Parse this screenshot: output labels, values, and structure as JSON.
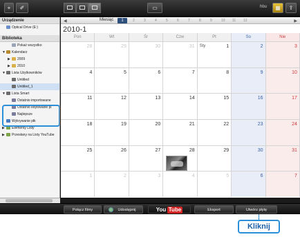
{
  "toolbar": {
    "add_label": "+",
    "tool_label": "✐",
    "tv_label": "hbu",
    "view_modes": [
      "list",
      "grid",
      "calendar"
    ],
    "active_view": "calendar"
  },
  "sidebar": {
    "device_header": "Urządzenie",
    "device_items": [
      {
        "label": "Optical Drive (E:)",
        "icon": "disc-icon"
      }
    ],
    "library_header": "Biblioteka",
    "library_items": [
      {
        "label": "Pokaż wszystko",
        "icon": "image-icon",
        "arrow": "",
        "indent": 1
      },
      {
        "label": "Kalendarz",
        "icon": "calendar-icon",
        "arrow": "▼",
        "indent": 0
      },
      {
        "label": "2009",
        "icon": "folder-icon",
        "arrow": "▶",
        "indent": 1
      },
      {
        "label": "2010",
        "icon": "folder-icon",
        "arrow": "▶",
        "indent": 1
      },
      {
        "label": "Lista Użytkowników",
        "icon": "film-icon",
        "arrow": "▼",
        "indent": 0
      },
      {
        "label": "Untitled",
        "icon": "film-icon",
        "arrow": "",
        "indent": 1
      },
      {
        "label": "Untitled_1",
        "icon": "film-icon",
        "arrow": "",
        "indent": 1,
        "selected": true
      },
      {
        "label": "Lista Smart",
        "icon": "film-icon",
        "arrow": "▼",
        "indent": 0
      },
      {
        "label": "Ostatnio importowane",
        "icon": "person-icon",
        "arrow": "",
        "indent": 1
      },
      {
        "label": "Ostatnio edytowane pl",
        "icon": "person-icon",
        "arrow": "",
        "indent": 1
      },
      {
        "label": "Najlepsze",
        "icon": "person-icon",
        "arrow": "",
        "indent": 1
      },
      {
        "label": "Wykrywanie płk",
        "icon": "tri-icon",
        "arrow": "",
        "indent": 0
      },
      {
        "label": "Elementy Listy",
        "icon": "note-icon",
        "arrow": "▶",
        "indent": 0
      },
      {
        "label": "Przesłany na Listy YouTube",
        "icon": "note-icon",
        "arrow": "▶",
        "indent": 0
      }
    ]
  },
  "calendar": {
    "nav_left": "◀",
    "nav_right": "▶",
    "month_label": "Miesiąc",
    "month_num": "1",
    "month_nums": [
      "2",
      "3",
      "4",
      "5",
      "6",
      "7",
      "8",
      "9",
      "10",
      "11",
      "12"
    ],
    "year_label": "2010-1",
    "weekdays": [
      "Pon",
      "Wt",
      "Śr",
      "Czw",
      "Pt",
      "So",
      "Nie"
    ],
    "weeks": [
      [
        {
          "n": "28",
          "o": true
        },
        {
          "n": "29",
          "o": true
        },
        {
          "n": "30",
          "o": true
        },
        {
          "n": "31",
          "o": true
        },
        {
          "n": "1",
          "m": "Sty"
        },
        {
          "n": "2"
        },
        {
          "n": "3"
        }
      ],
      [
        {
          "n": "4"
        },
        {
          "n": "5"
        },
        {
          "n": "6"
        },
        {
          "n": "7"
        },
        {
          "n": "8"
        },
        {
          "n": "9"
        },
        {
          "n": "10"
        }
      ],
      [
        {
          "n": "11"
        },
        {
          "n": "12"
        },
        {
          "n": "13"
        },
        {
          "n": "14"
        },
        {
          "n": "15"
        },
        {
          "n": "16"
        },
        {
          "n": "17"
        }
      ],
      [
        {
          "n": "18"
        },
        {
          "n": "19"
        },
        {
          "n": "20"
        },
        {
          "n": "21"
        },
        {
          "n": "22"
        },
        {
          "n": "23"
        },
        {
          "n": "24"
        }
      ],
      [
        {
          "n": "25"
        },
        {
          "n": "26"
        },
        {
          "n": "27"
        },
        {
          "n": "28",
          "thumb": true
        },
        {
          "n": "29"
        },
        {
          "n": "30"
        },
        {
          "n": "31"
        }
      ],
      [
        {
          "n": "1",
          "o": true
        },
        {
          "n": "2",
          "o": true
        },
        {
          "n": "3",
          "o": true
        },
        {
          "n": "4",
          "o": true
        },
        {
          "n": "5",
          "o": true
        },
        {
          "n": "6",
          "o": true
        },
        {
          "n": "7",
          "o": true
        }
      ]
    ]
  },
  "bottombar": {
    "film_label": "Połącz filmy",
    "share_label": "Udostępnij",
    "youtube_you": "You",
    "youtube_tube": "Tube",
    "export_label": "Eksport",
    "create_label": "Utwórz płytę"
  },
  "callout": {
    "label": "Kliknij"
  }
}
